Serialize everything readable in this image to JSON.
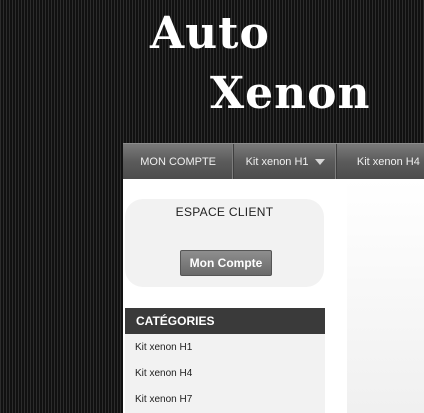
{
  "logo": {
    "line1": "Auto",
    "line2": "Xenon"
  },
  "nav": {
    "items": [
      {
        "label": "MON COMPTE"
      },
      {
        "label": "Kit xenon H1",
        "icon": "chevron-down-icon"
      },
      {
        "label": "Kit xenon H4"
      }
    ]
  },
  "client": {
    "title": "ESPACE CLIENT",
    "button_label": "Mon Compte"
  },
  "categories": {
    "title": "CATÉGORIES",
    "items": [
      {
        "label": "Kit xenon H1"
      },
      {
        "label": "Kit xenon H4"
      },
      {
        "label": "Kit xenon H7"
      }
    ]
  }
}
